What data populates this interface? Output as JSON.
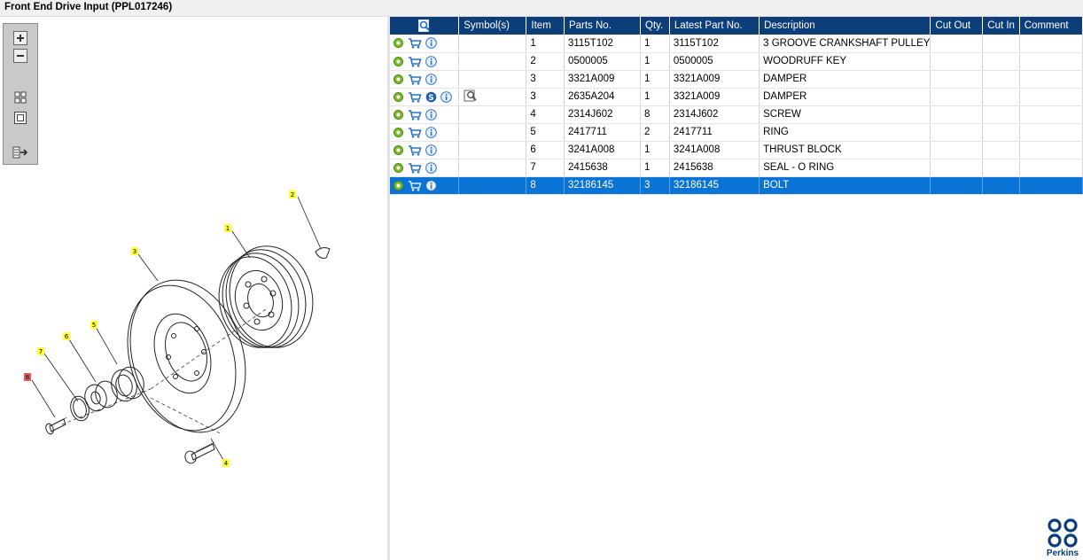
{
  "window": {
    "title": "Front End Drive Input (PPL017246)"
  },
  "table": {
    "headers": {
      "symbols": "Symbol(s)",
      "item": "Item",
      "parts_no": "Parts No.",
      "qty": "Qty.",
      "latest_part_no": "Latest Part No.",
      "description": "Description",
      "cut_out": "Cut Out",
      "cut_in": "Cut In",
      "comment": "Comment"
    },
    "rows": [
      {
        "item": "1",
        "parts_no": "3115T102",
        "qty": "1",
        "latest_part_no": "3115T102",
        "description": "3 GROOVE CRANKSHAFT PULLEY"
      },
      {
        "item": "2",
        "parts_no": "0500005",
        "qty": "1",
        "latest_part_no": "0500005",
        "description": "WOODRUFF KEY"
      },
      {
        "item": "3",
        "parts_no": "3321A009",
        "qty": "1",
        "latest_part_no": "3321A009",
        "description": "DAMPER"
      },
      {
        "item": "3",
        "parts_no": "2635A204",
        "qty": "1",
        "latest_part_no": "3321A009",
        "description": "DAMPER"
      },
      {
        "item": "4",
        "parts_no": "2314J602",
        "qty": "8",
        "latest_part_no": "2314J602",
        "description": "SCREW"
      },
      {
        "item": "5",
        "parts_no": "2417711",
        "qty": "2",
        "latest_part_no": "2417711",
        "description": "RING"
      },
      {
        "item": "6",
        "parts_no": "3241A008",
        "qty": "1",
        "latest_part_no": "3241A008",
        "description": "THRUST BLOCK"
      },
      {
        "item": "7",
        "parts_no": "2415638",
        "qty": "1",
        "latest_part_no": "2415638",
        "description": "SEAL - O RING"
      },
      {
        "item": "8",
        "parts_no": "32186145",
        "qty": "3",
        "latest_part_no": "32186145",
        "description": "BOLT"
      }
    ],
    "row3_symbol": "S",
    "selected_row": "8"
  },
  "diagram": {
    "callouts": {
      "c1": "1",
      "c2": "2",
      "c3": "3",
      "c4": "4",
      "c5": "5",
      "c6": "6",
      "c7": "7",
      "c8": "8"
    }
  },
  "logo": {
    "text": "Perkins"
  },
  "icons": {
    "zoom_in": "zoom-in-icon",
    "zoom_out": "zoom-out-icon",
    "fit": "fit-all-icon",
    "actual": "actual-size-icon",
    "export": "export-icon",
    "search": "search-doc-icon",
    "cog": "cog-icon",
    "cart": "cart-icon",
    "info": "info-icon"
  },
  "colors": {
    "header": "#0d3e7a",
    "selection": "#0a73d6",
    "callout_normal": "#ffff33",
    "callout_selected": "#e85a5a"
  }
}
